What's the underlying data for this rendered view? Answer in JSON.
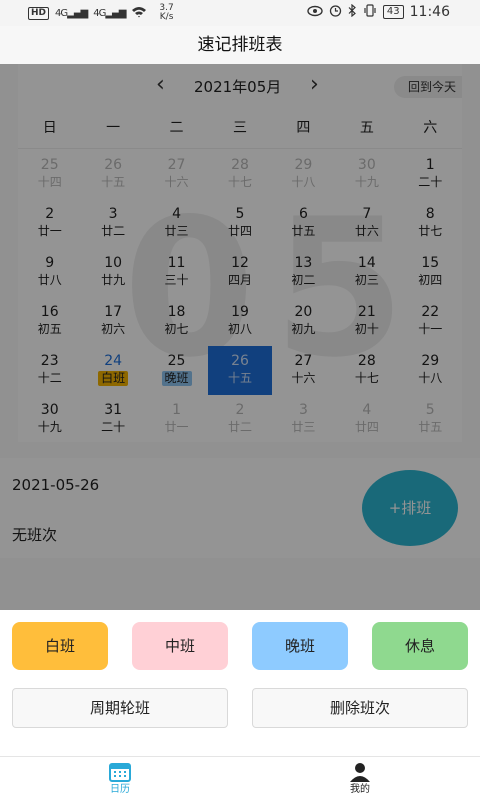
{
  "status_bar": {
    "hd": "HD",
    "signal1": "4G",
    "signal2": "4G",
    "speed_value": "3.7",
    "speed_unit": "K/s",
    "battery": "43",
    "time": "11:46"
  },
  "app_title": "速记排班表",
  "calendar": {
    "month_label": "2021年05月",
    "today_button": "回到今天",
    "big_month": "05",
    "weekdays": [
      "日",
      "一",
      "二",
      "三",
      "四",
      "五",
      "六"
    ],
    "days": [
      {
        "num": "25",
        "lunar": "十四",
        "state": "other"
      },
      {
        "num": "26",
        "lunar": "十五",
        "state": "other"
      },
      {
        "num": "27",
        "lunar": "十六",
        "state": "other"
      },
      {
        "num": "28",
        "lunar": "十七",
        "state": "other"
      },
      {
        "num": "29",
        "lunar": "十八",
        "state": "other"
      },
      {
        "num": "30",
        "lunar": "十九",
        "state": "other"
      },
      {
        "num": "1",
        "lunar": "二十",
        "state": "normal"
      },
      {
        "num": "2",
        "lunar": "廿一",
        "state": "normal"
      },
      {
        "num": "3",
        "lunar": "廿二",
        "state": "normal"
      },
      {
        "num": "4",
        "lunar": "廿三",
        "state": "normal"
      },
      {
        "num": "5",
        "lunar": "廿四",
        "state": "normal"
      },
      {
        "num": "6",
        "lunar": "廿五",
        "state": "normal"
      },
      {
        "num": "7",
        "lunar": "廿六",
        "state": "normal"
      },
      {
        "num": "8",
        "lunar": "廿七",
        "state": "normal"
      },
      {
        "num": "9",
        "lunar": "廿八",
        "state": "normal"
      },
      {
        "num": "10",
        "lunar": "廿九",
        "state": "normal"
      },
      {
        "num": "11",
        "lunar": "三十",
        "state": "normal"
      },
      {
        "num": "12",
        "lunar": "四月",
        "state": "normal"
      },
      {
        "num": "13",
        "lunar": "初二",
        "state": "normal"
      },
      {
        "num": "14",
        "lunar": "初三",
        "state": "normal"
      },
      {
        "num": "15",
        "lunar": "初四",
        "state": "normal"
      },
      {
        "num": "16",
        "lunar": "初五",
        "state": "normal"
      },
      {
        "num": "17",
        "lunar": "初六",
        "state": "normal"
      },
      {
        "num": "18",
        "lunar": "初七",
        "state": "normal"
      },
      {
        "num": "19",
        "lunar": "初八",
        "state": "normal"
      },
      {
        "num": "20",
        "lunar": "初九",
        "state": "normal"
      },
      {
        "num": "21",
        "lunar": "初十",
        "state": "normal"
      },
      {
        "num": "22",
        "lunar": "十一",
        "state": "normal"
      },
      {
        "num": "23",
        "lunar": "十二",
        "state": "normal"
      },
      {
        "num": "24",
        "lunar": "白班",
        "state": "today",
        "tag_color": "#f5b400"
      },
      {
        "num": "25",
        "lunar": "晚班",
        "state": "normal",
        "tag_color": "#8ec5f2"
      },
      {
        "num": "26",
        "lunar": "十五",
        "state": "selected"
      },
      {
        "num": "27",
        "lunar": "十六",
        "state": "normal"
      },
      {
        "num": "28",
        "lunar": "十七",
        "state": "normal"
      },
      {
        "num": "29",
        "lunar": "十八",
        "state": "normal"
      },
      {
        "num": "30",
        "lunar": "十九",
        "state": "normal"
      },
      {
        "num": "31",
        "lunar": "二十",
        "state": "normal"
      },
      {
        "num": "1",
        "lunar": "廿一",
        "state": "other"
      },
      {
        "num": "2",
        "lunar": "廿二",
        "state": "other"
      },
      {
        "num": "3",
        "lunar": "廿三",
        "state": "other"
      },
      {
        "num": "4",
        "lunar": "廿四",
        "state": "other"
      },
      {
        "num": "5",
        "lunar": "廿五",
        "state": "other"
      }
    ]
  },
  "info": {
    "date": "2021-05-26",
    "status": "无班次",
    "add_button": "+排班"
  },
  "sheet": {
    "shifts": [
      {
        "label": "白班",
        "color": "#ffbe3b"
      },
      {
        "label": "中班",
        "color": "#ffd0d6"
      },
      {
        "label": "晚班",
        "color": "#8ecbff"
      },
      {
        "label": "休息",
        "color": "#8fd98f"
      }
    ],
    "cycle_button": "周期轮班",
    "delete_button": "删除班次"
  },
  "tabbar": {
    "calendar_label": "日历",
    "mine_label": "我的",
    "active_color": "#29a9d8"
  }
}
